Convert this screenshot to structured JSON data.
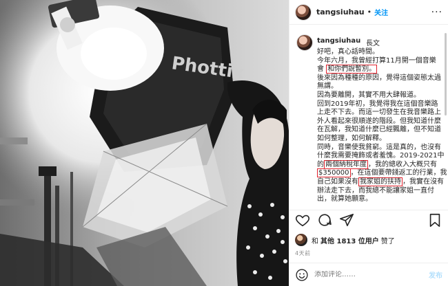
{
  "post_header": {
    "username": "tangsiuhau",
    "separator": "•",
    "follow_label": "关注",
    "more_label": "···"
  },
  "caption": {
    "username": "tangsiuhau",
    "edited_label": "長文",
    "lines": [
      "好吧，真心話時間。",
      "今年六月，我曾經打算11月開一個音樂",
      "會",
      "和你們說暫別。",
      "後來因為種種的原因，覺得這個姿態太過",
      "無謂。",
      "因為要離開，其實不用大肆報道。",
      "回到2019年初，我覺得我在這個音樂路",
      "上走不下去。而這一切發生在我音樂路上",
      "外人看起來很順遂的階段。但我知道什麼",
      "在瓦解，我知道什麼已經飄離，但不知道",
      "如何整理，如何解釋。",
      "同時，音樂使我貧窮。這是真的，也沒有",
      "什麼我需要掩飾或者羞愧。2019-2021中",
      "的",
      "兩個納稅年度",
      "，我的總收入大概只有",
      "$350000",
      "，在這個要帶錢返工的行業，我",
      "自己如果沒有",
      "我家姐的扶持",
      "，我實在沒有",
      "辦法走下去，而我總不能讓家姐一直付",
      "出，就算她願意。"
    ]
  },
  "likes": {
    "prefix": "和",
    "others_label": "其他 1813 位用户",
    "suffix": "赞了"
  },
  "timestamp": "4天前",
  "comment_input": {
    "placeholder": "添加评论……",
    "post_label": "发布"
  },
  "photo": {
    "brand_text": "Phottix",
    "brand_color": "#c8c8c8"
  },
  "colors": {
    "accent": "#0095f6",
    "highlight_box": "#e0202b"
  }
}
